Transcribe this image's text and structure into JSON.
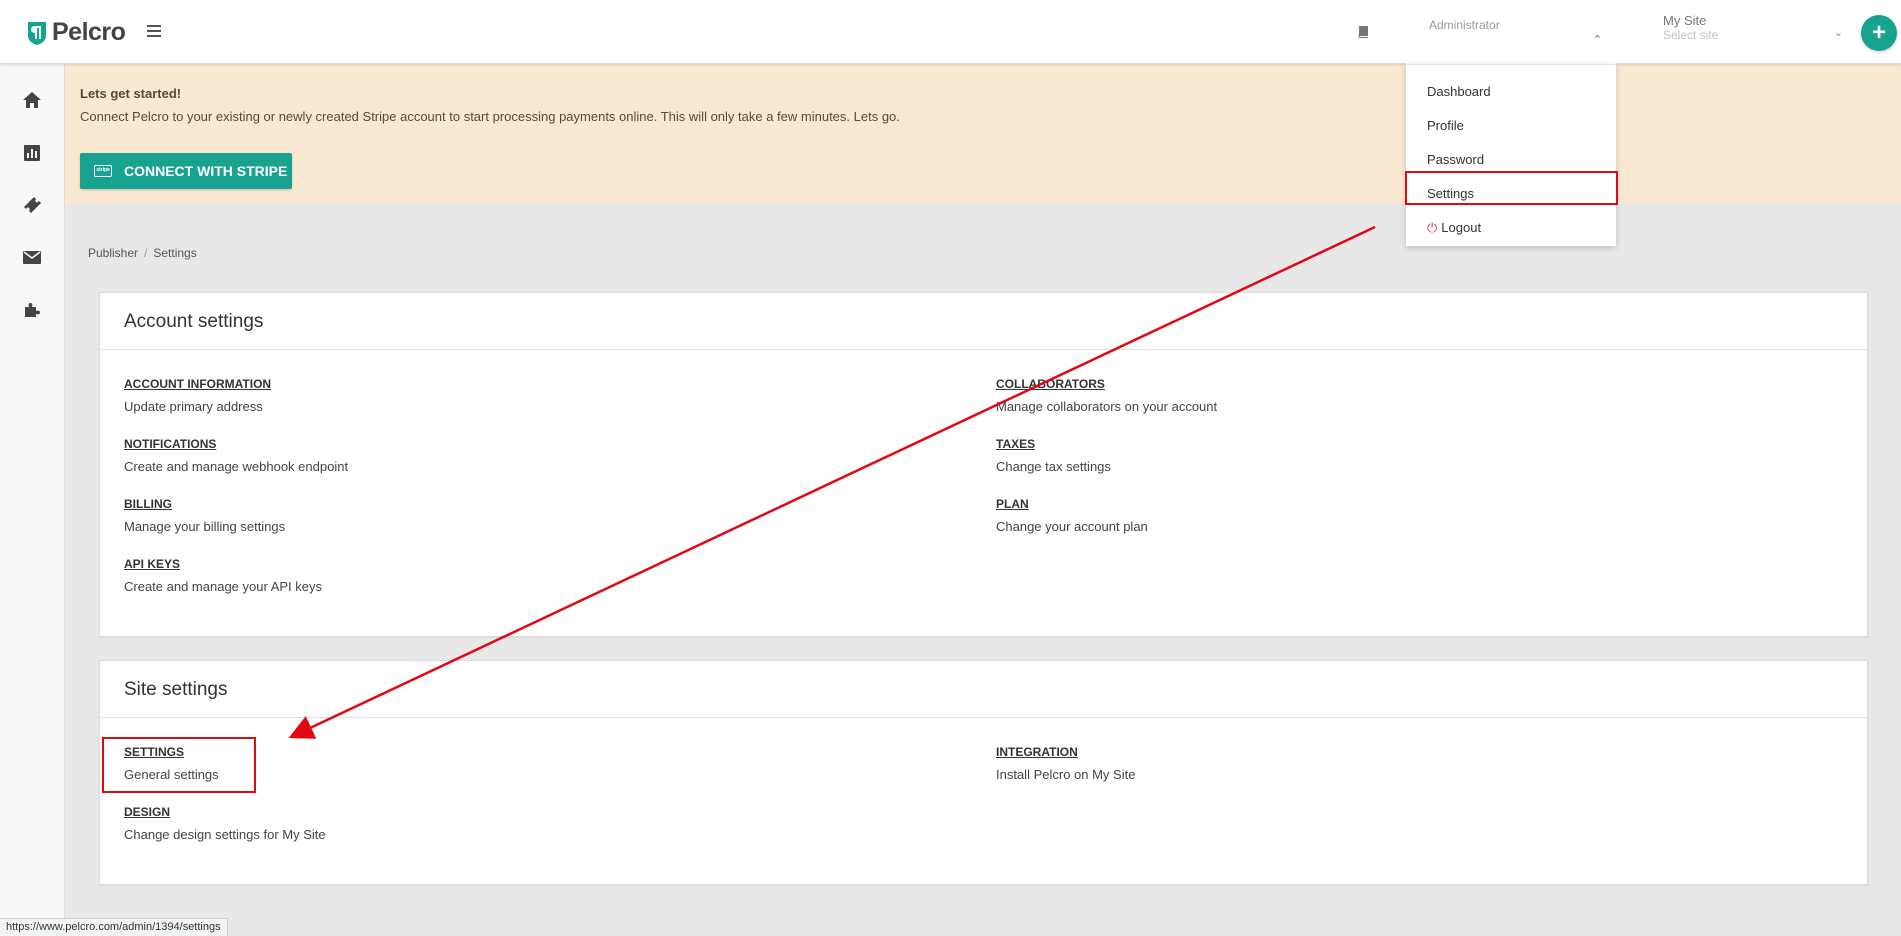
{
  "app": {
    "brand": "Pelcro",
    "brand_color": "#17a390"
  },
  "header": {
    "account_select_label": "Administrator",
    "site_select_label": "My Site",
    "site_select_placeholder": "Select site",
    "add_label": "+"
  },
  "account_menu": {
    "items": [
      "Dashboard",
      "Profile",
      "Password",
      "Settings"
    ],
    "logout": "Logout"
  },
  "sidebar": {
    "icons": [
      "home-icon",
      "chart-icon",
      "ticket-icon",
      "mail-icon",
      "puzzle-icon"
    ]
  },
  "banner": {
    "title": "Lets get started!",
    "description": "Connect Pelcro to your existing or newly created Stripe account to start processing payments online. This will only take a few minutes. Lets go.",
    "button_label": "CONNECT WITH STRIPE",
    "button_icon_text": "stripe"
  },
  "breadcrumb": {
    "parent": "Publisher",
    "separator": "/",
    "current": "Settings"
  },
  "account_settings": {
    "title": "Account settings",
    "items": [
      {
        "heading": "ACCOUNT INFORMATION",
        "description": "Update primary address"
      },
      {
        "heading": "NOTIFICATIONS",
        "description": "Create and manage webhook endpoint"
      },
      {
        "heading": "BILLING",
        "description": "Manage your billing settings"
      },
      {
        "heading": "API KEYS",
        "description": "Create and manage your API keys"
      },
      {
        "heading": "COLLABORATORS",
        "description": "Manage collaborators on your account"
      },
      {
        "heading": "TAXES",
        "description": "Change tax settings"
      },
      {
        "heading": "PLAN",
        "description": "Change your account plan"
      }
    ]
  },
  "site_settings": {
    "title": "Site settings",
    "items": [
      {
        "heading": "SETTINGS",
        "description": "General settings"
      },
      {
        "heading": "DESIGN",
        "description": "Change design settings for My Site"
      },
      {
        "heading": "INTEGRATION",
        "description": "Install Pelcro on My Site"
      }
    ]
  },
  "annotations": {
    "color": "#e30613"
  },
  "status_url": "https://www.pelcro.com/admin/1394/settings"
}
